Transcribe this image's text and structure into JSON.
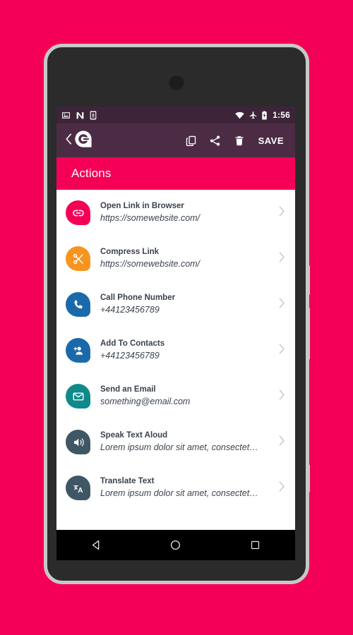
{
  "theme": {
    "page_background": "#f50057",
    "accent": "#f50057",
    "appbar_background": "#4c2c45",
    "statusbar_background": "#3d2438",
    "frame_border": "#c6c9c6",
    "frame_body": "#2b2b2b",
    "navbar_background": "#000000",
    "title_text": "#39424e"
  },
  "status_bar": {
    "left_icons": [
      "image-icon",
      "android-n-icon",
      "download-to-device-icon"
    ],
    "right_icons": [
      "wifi-icon",
      "airplane-mode-icon",
      "battery-charging-icon"
    ],
    "clock": "1:56"
  },
  "app_bar": {
    "back_label": "back-chevron",
    "logo_label": "app-logo",
    "actions": [
      {
        "name": "copy-icon",
        "label": "Copy"
      },
      {
        "name": "share-icon",
        "label": "Share"
      },
      {
        "name": "delete-icon",
        "label": "Delete"
      }
    ],
    "save_label": "SAVE"
  },
  "section": {
    "title": "Actions"
  },
  "actions": [
    {
      "title": "Open Link in Browser",
      "subtitle": "https://somewebsite.com/",
      "icon": "link-icon",
      "color": "#f50057"
    },
    {
      "title": "Compress Link",
      "subtitle": "https://somewebsite.com/",
      "icon": "scissors-icon",
      "color": "#f7941d"
    },
    {
      "title": "Call Phone Number",
      "subtitle": "+44123456789",
      "icon": "phone-icon",
      "color": "#1a6aab"
    },
    {
      "title": "Add To Contacts",
      "subtitle": "+44123456789",
      "icon": "person-add-icon",
      "color": "#1a6aab"
    },
    {
      "title": "Send an Email",
      "subtitle": "something@email.com",
      "icon": "envelope-icon",
      "color": "#0e8a8a"
    },
    {
      "title": "Speak Text Aloud",
      "subtitle": "Lorem ipsum dolor sit amet, consectet…",
      "icon": "speaker-icon",
      "color": "#3f5665"
    },
    {
      "title": "Translate Text",
      "subtitle": "Lorem ipsum dolor sit amet, consectet…",
      "icon": "translate-icon",
      "color": "#3f5665"
    }
  ],
  "nav_bar": {
    "back": "back-triangle-icon",
    "home": "home-circle-icon",
    "recents": "recents-square-icon"
  }
}
